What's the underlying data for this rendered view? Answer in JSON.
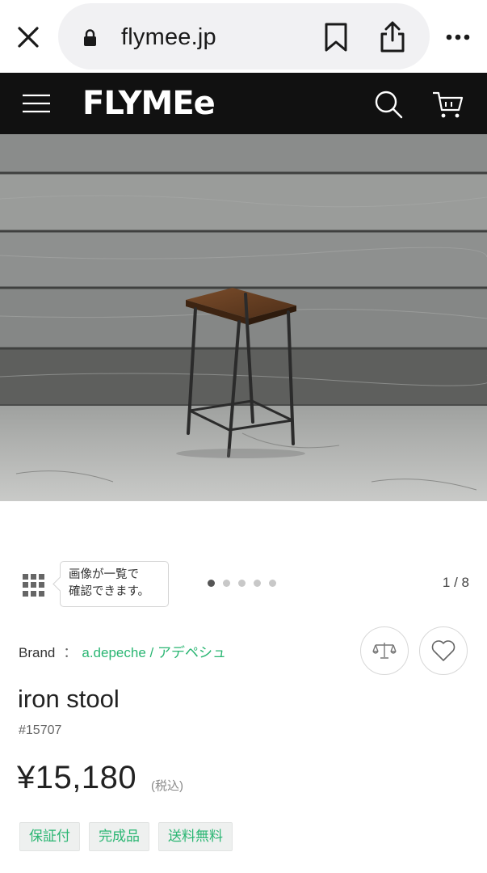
{
  "browser": {
    "url": "flymee.jp",
    "icons": [
      "close-icon",
      "lock-icon",
      "bookmark-icon",
      "share-icon",
      "more-icon"
    ]
  },
  "header": {
    "logo": "FLYMEe",
    "icons": [
      "menu-icon",
      "search-icon",
      "cart-icon"
    ]
  },
  "gallery": {
    "tooltip_line1": "画像が一覧で",
    "tooltip_line2": "確認できます。",
    "current_index": 1,
    "dot_count": 5,
    "counter": "1 / 8"
  },
  "product": {
    "brand_label": "Brand",
    "brand_separator": "：",
    "brand_name": "a.depeche / アデペシュ",
    "name": "iron stool",
    "id": "#15707",
    "price": "¥15,180",
    "tax_note": "(税込)",
    "tags": [
      "保証付",
      "完成品",
      "送料無料"
    ]
  },
  "colors": {
    "accent": "#2bb673",
    "header_bg": "#111111",
    "url_pill_bg": "#f1f1f3"
  }
}
